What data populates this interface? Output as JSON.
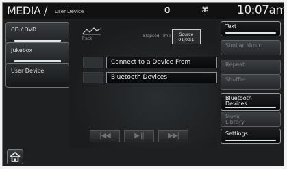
{
  "status": {
    "title": "MEDIA /",
    "subtitle": "User Device",
    "channel": "0",
    "antenna": "⌘",
    "clock": "10:07am"
  },
  "tabs": [
    {
      "label": "CD / DVD"
    },
    {
      "label": "Jukebox"
    },
    {
      "label": "User Device"
    }
  ],
  "main": {
    "track_label": "Track",
    "elapsed_label": "Elapsed Time",
    "elapsed_value": "Source 01:00:1",
    "rows": [
      {
        "label": "Connect to a Device From"
      },
      {
        "label": "Bluetooth Devices"
      }
    ],
    "transport": {
      "prev": "|◀◀",
      "play": "▶ ||",
      "next": "▶▶|"
    }
  },
  "right_buttons": {
    "text": "Text",
    "similar": "Similar Music",
    "repeat": "Repeat",
    "shuffle": "Shuffle",
    "bluetooth_line1": "Bluetooth",
    "bluetooth_line2": "Devices",
    "music_line1": "Music",
    "music_line2": "Library",
    "settings": "Settings"
  },
  "icons": {
    "home": "home-icon",
    "track": "music-note-icon"
  }
}
